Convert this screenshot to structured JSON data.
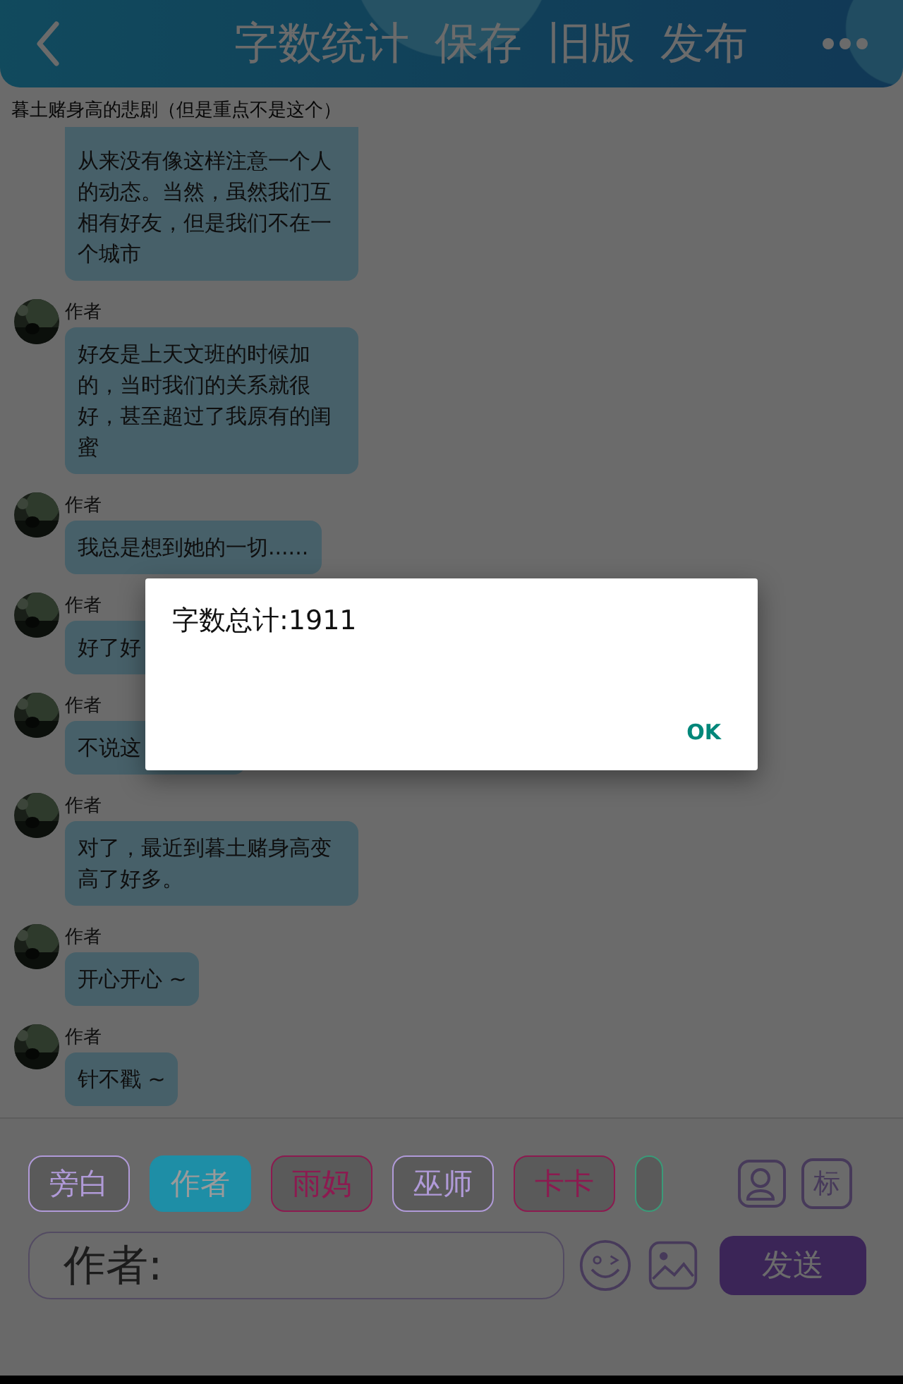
{
  "header": {
    "actions": [
      "字数统计",
      "保存",
      "旧版",
      "发布"
    ]
  },
  "subtitle": "暮土赌身高的悲剧（但是重点不是这个）",
  "messages": [
    {
      "kind": "cut",
      "text": "从来没有像这样注意一个人的动态。当然，虽然我们互相有好友，但是我们不在一个城市"
    },
    {
      "kind": "full",
      "name": "作者",
      "text": "好友是上天文班的时候加的，当时我们的关系就很好，甚至超过了我原有的闺蜜"
    },
    {
      "kind": "full",
      "name": "作者",
      "text": "我总是想到她的一切......"
    },
    {
      "kind": "covered",
      "name": "作者",
      "text": "好了好"
    },
    {
      "kind": "covered",
      "name": "作者",
      "text": "不说这"
    },
    {
      "kind": "full",
      "name": "作者",
      "text": "对了，最近到暮土赌身高变高了好多。"
    },
    {
      "kind": "full",
      "name": "作者",
      "text": "开心开心 ~"
    },
    {
      "kind": "full",
      "name": "作者",
      "text": "针不戳 ~"
    }
  ],
  "roles": [
    {
      "label": "旁白",
      "color": "#b09ad8",
      "selected": false
    },
    {
      "label": "作者",
      "color": "#1e8ea6",
      "selected": true
    },
    {
      "label": "雨妈",
      "color": "#8c1a50",
      "selected": false
    },
    {
      "label": "巫师",
      "color": "#b09ad8",
      "selected": false
    },
    {
      "label": "卡卡",
      "color": "#8c1a50",
      "selected": false
    },
    {
      "color": "#3a9a78",
      "selected": false
    }
  ],
  "tag_button": "标",
  "input": {
    "value": "作者:"
  },
  "send_button": "发送",
  "dialog": {
    "message": "字数总计:1911",
    "button": "OK"
  }
}
